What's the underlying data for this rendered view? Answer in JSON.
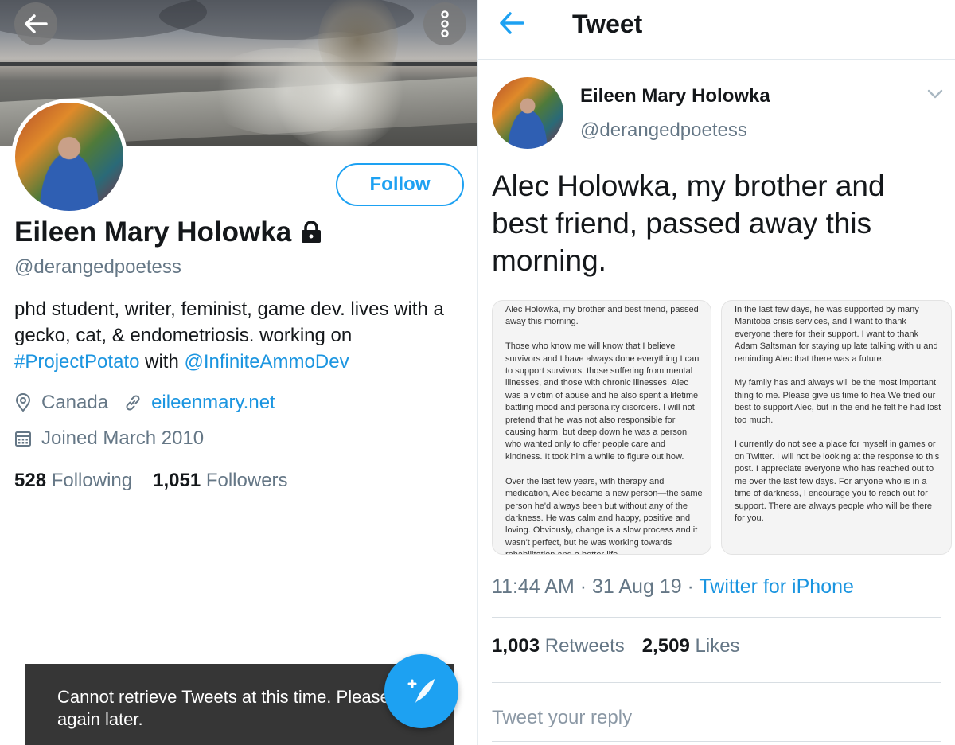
{
  "profile": {
    "follow_label": "Follow",
    "name": "Eileen Mary Holowka",
    "handle": "@derangedpoetess",
    "bio_prefix": "phd student, writer, feminist, game dev. lives with a gecko, cat, & endometriosis. working on",
    "bio_hashtag": "#ProjectPotato",
    "bio_with": "with",
    "bio_mention": "@InfiniteAmmoDev",
    "location": "Canada",
    "website": "eileenmary.net",
    "joined": "Joined March 2010",
    "following_count": "528",
    "following_label": "Following",
    "followers_count": "1,051",
    "followers_label": "Followers",
    "toast": "Cannot retrieve Tweets at this time. Please try again later."
  },
  "tweet": {
    "header_title": "Tweet",
    "author_name": "Eileen Mary Holowka",
    "author_handle": "@derangedpoetess",
    "text": "Alec Holowka, my brother and best friend, passed away this morning.",
    "image_1_text": "Alec Holowka, my brother and best friend, passed away this morning.\n\nThose who know me will know that I believe survivors and I have always done everything I can to support survivors, those suffering from mental illnesses, and those with chronic illnesses. Alec was a victim of abuse and he also spent a lifetime battling mood and personality disorders. I will not pretend that he was not also responsible for causing harm, but deep down he was a person who wanted only to offer people care and kindness. It took him a while to figure out how.\n\nOver the last few years, with therapy and medication, Alec became a new person—the same person he'd always been but without any of the darkness. He was calm and happy, positive and loving. Obviously, change is a slow process and it wasn't perfect, but he was working towards rehabilitation and a better life.",
    "image_2_text": "In the last few days, he was supported by many Manitoba crisis services, and I want to thank everyone there for their support. I want to thank Adam Saltsman for staying up late talking with u and reminding Alec that there was a future.\n\nMy family has and always will be the most important thing to me. Please give us time to hea We tried our best to support Alec, but in the end he felt he had lost too much.\n\nI currently do not see a place for myself in games or on Twitter. I will not be looking at the response to this post. I appreciate everyone who has reached out to me over the last few days. For anyone who is in a time of darkness, I encourage you to reach out for support. There are always people who will be there for you.",
    "time": "11:44 AM · 31 Aug 19 · ",
    "source": "Twitter for iPhone",
    "retweets_count": "1,003",
    "retweets_label": "Retweets",
    "likes_count": "2,509",
    "likes_label": "Likes",
    "reply_placeholder": "Tweet your reply"
  },
  "icons": {
    "back": "arrow-left-icon",
    "more": "more-vertical-icon",
    "lock": "lock-icon",
    "location": "location-pin-icon",
    "link": "link-icon",
    "calendar": "calendar-icon",
    "compose": "compose-icon",
    "chevron": "chevron-down-icon"
  },
  "colors": {
    "accent": "#1da1f2",
    "link": "#1b95e0",
    "muted": "#657786",
    "toast_bg": "#363636"
  }
}
